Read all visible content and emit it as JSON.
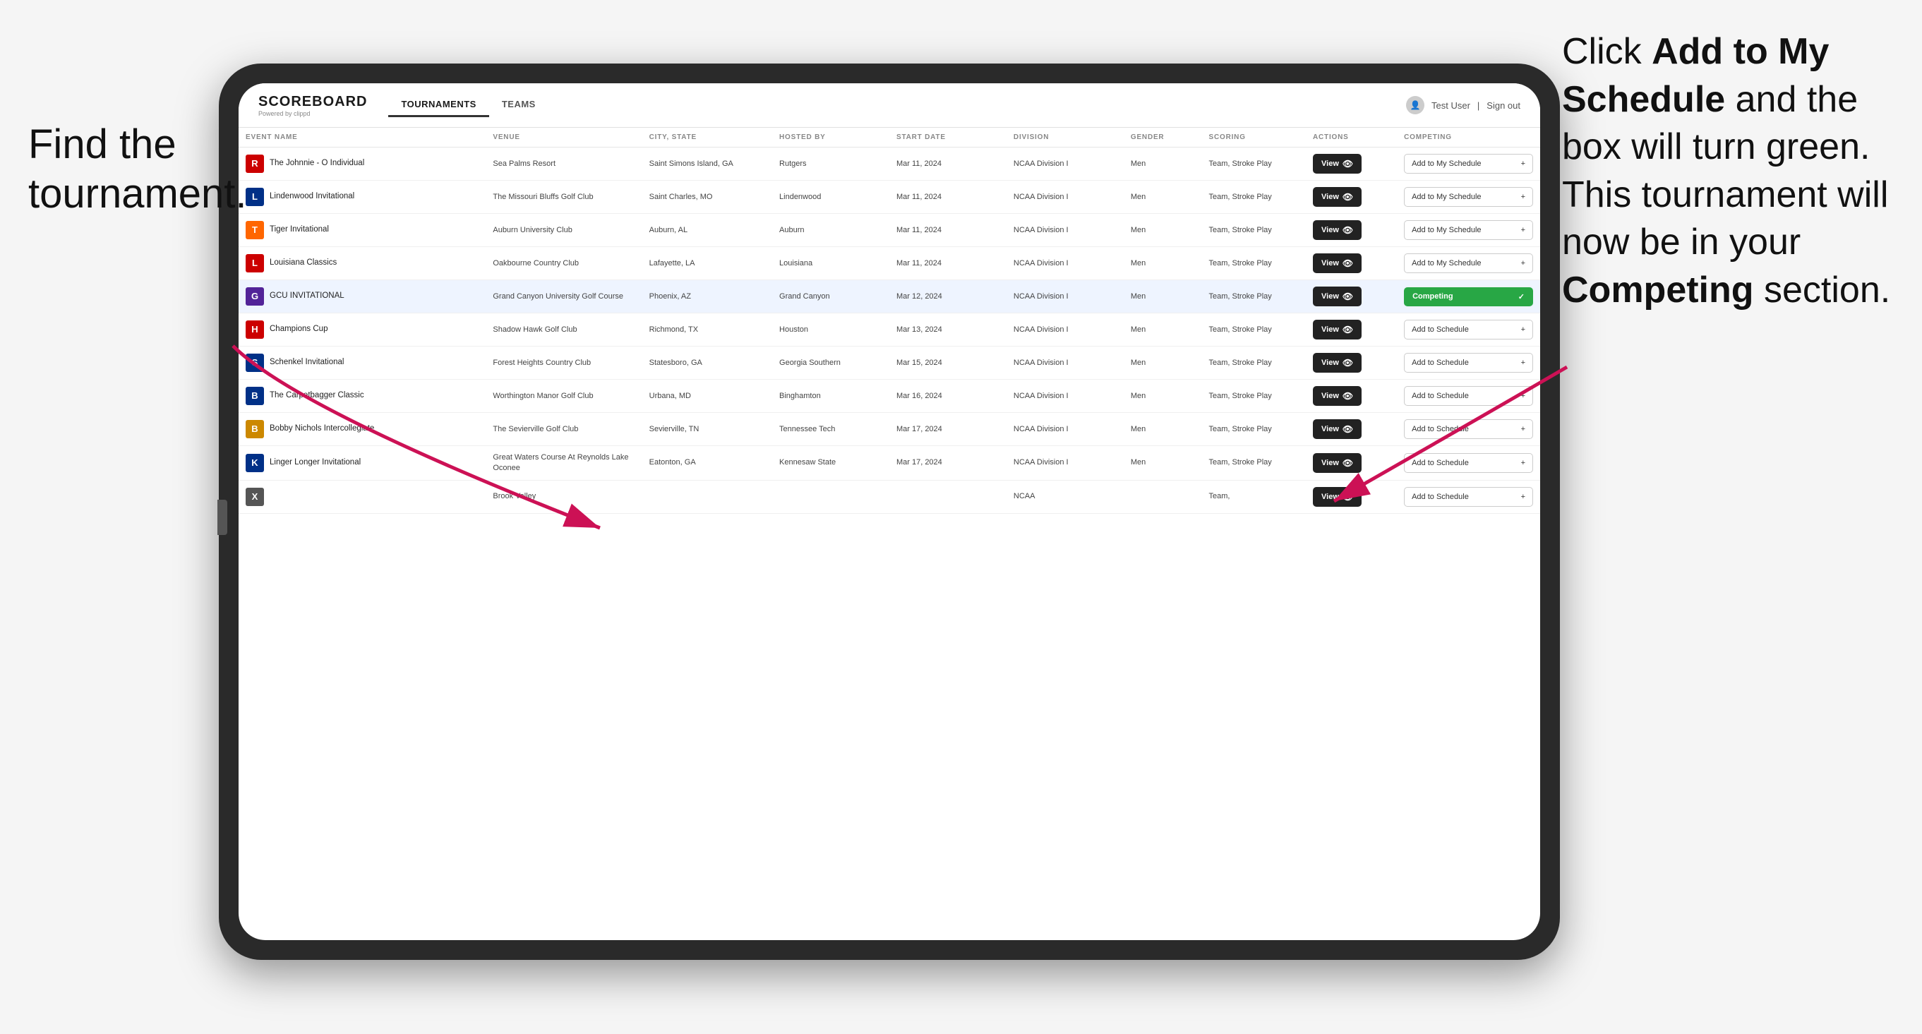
{
  "annotations": {
    "left_text_line1": "Find the",
    "left_text_line2": "tournament.",
    "right_text": "Click ",
    "right_bold1": "Add to My Schedule",
    "right_text2": " and the box will turn green. This tournament will now be in your ",
    "right_bold2": "Competing",
    "right_text3": " section."
  },
  "nav": {
    "logo": "SCOREBOARD",
    "logo_sub": "Powered by clippd",
    "tabs": [
      "TOURNAMENTS",
      "TEAMS"
    ],
    "active_tab": "TOURNAMENTS",
    "user": "Test User",
    "sign_out": "Sign out"
  },
  "table": {
    "columns": [
      "EVENT NAME",
      "VENUE",
      "CITY, STATE",
      "HOSTED BY",
      "START DATE",
      "DIVISION",
      "GENDER",
      "SCORING",
      "ACTIONS",
      "COMPETING"
    ],
    "rows": [
      {
        "logo": "R",
        "logo_color": "#cc0000",
        "event": "The Johnnie - O Individual",
        "venue": "Sea Palms Resort",
        "city": "Saint Simons Island, GA",
        "hosted": "Rutgers",
        "date": "Mar 11, 2024",
        "division": "NCAA Division I",
        "gender": "Men",
        "scoring": "Team, Stroke Play",
        "action": "View",
        "competing_label": "Add to My Schedule",
        "is_competing": false
      },
      {
        "logo": "L",
        "logo_color": "#003087",
        "event": "Lindenwood Invitational",
        "venue": "The Missouri Bluffs Golf Club",
        "city": "Saint Charles, MO",
        "hosted": "Lindenwood",
        "date": "Mar 11, 2024",
        "division": "NCAA Division I",
        "gender": "Men",
        "scoring": "Team, Stroke Play",
        "action": "View",
        "competing_label": "Add to My Schedule",
        "is_competing": false
      },
      {
        "logo": "T",
        "logo_color": "#FF6600",
        "event": "Tiger Invitational",
        "venue": "Auburn University Club",
        "city": "Auburn, AL",
        "hosted": "Auburn",
        "date": "Mar 11, 2024",
        "division": "NCAA Division I",
        "gender": "Men",
        "scoring": "Team, Stroke Play",
        "action": "View",
        "competing_label": "Add to My Schedule",
        "is_competing": false
      },
      {
        "logo": "L",
        "logo_color": "#cc0000",
        "event": "Louisiana Classics",
        "venue": "Oakbourne Country Club",
        "city": "Lafayette, LA",
        "hosted": "Louisiana",
        "date": "Mar 11, 2024",
        "division": "NCAA Division I",
        "gender": "Men",
        "scoring": "Team, Stroke Play",
        "action": "View",
        "competing_label": "Add to My Schedule",
        "is_competing": false
      },
      {
        "logo": "G",
        "logo_color": "#522398",
        "event": "GCU INVITATIONAL",
        "venue": "Grand Canyon University Golf Course",
        "city": "Phoenix, AZ",
        "hosted": "Grand Canyon",
        "date": "Mar 12, 2024",
        "division": "NCAA Division I",
        "gender": "Men",
        "scoring": "Team, Stroke Play",
        "action": "View",
        "competing_label": "Competing",
        "is_competing": true
      },
      {
        "logo": "H",
        "logo_color": "#cc0000",
        "event": "Champions Cup",
        "venue": "Shadow Hawk Golf Club",
        "city": "Richmond, TX",
        "hosted": "Houston",
        "date": "Mar 13, 2024",
        "division": "NCAA Division I",
        "gender": "Men",
        "scoring": "Team, Stroke Play",
        "action": "View",
        "competing_label": "Add to Schedule",
        "is_competing": false
      },
      {
        "logo": "S",
        "logo_color": "#003087",
        "event": "Schenkel Invitational",
        "venue": "Forest Heights Country Club",
        "city": "Statesboro, GA",
        "hosted": "Georgia Southern",
        "date": "Mar 15, 2024",
        "division": "NCAA Division I",
        "gender": "Men",
        "scoring": "Team, Stroke Play",
        "action": "View",
        "competing_label": "Add to Schedule",
        "is_competing": false
      },
      {
        "logo": "B",
        "logo_color": "#003087",
        "event": "The Carpetbagger Classic",
        "venue": "Worthington Manor Golf Club",
        "city": "Urbana, MD",
        "hosted": "Binghamton",
        "date": "Mar 16, 2024",
        "division": "NCAA Division I",
        "gender": "Men",
        "scoring": "Team, Stroke Play",
        "action": "View",
        "competing_label": "Add to Schedule",
        "is_competing": false
      },
      {
        "logo": "B",
        "logo_color": "#cc8800",
        "event": "Bobby Nichols Intercollegiate",
        "venue": "The Sevierville Golf Club",
        "city": "Sevierville, TN",
        "hosted": "Tennessee Tech",
        "date": "Mar 17, 2024",
        "division": "NCAA Division I",
        "gender": "Men",
        "scoring": "Team, Stroke Play",
        "action": "View",
        "competing_label": "Add to Schedule",
        "is_competing": false
      },
      {
        "logo": "K",
        "logo_color": "#003087",
        "event": "Linger Longer Invitational",
        "venue": "Great Waters Course At Reynolds Lake Oconee",
        "city": "Eatonton, GA",
        "hosted": "Kennesaw State",
        "date": "Mar 17, 2024",
        "division": "NCAA Division I",
        "gender": "Men",
        "scoring": "Team, Stroke Play",
        "action": "View",
        "competing_label": "Add to Schedule",
        "is_competing": false
      },
      {
        "logo": "X",
        "logo_color": "#555",
        "event": "",
        "venue": "Brook Valley",
        "city": "",
        "hosted": "",
        "date": "",
        "division": "NCAA",
        "gender": "",
        "scoring": "Team,",
        "action": "View",
        "competing_label": "Add to Schedule",
        "is_competing": false
      }
    ]
  }
}
